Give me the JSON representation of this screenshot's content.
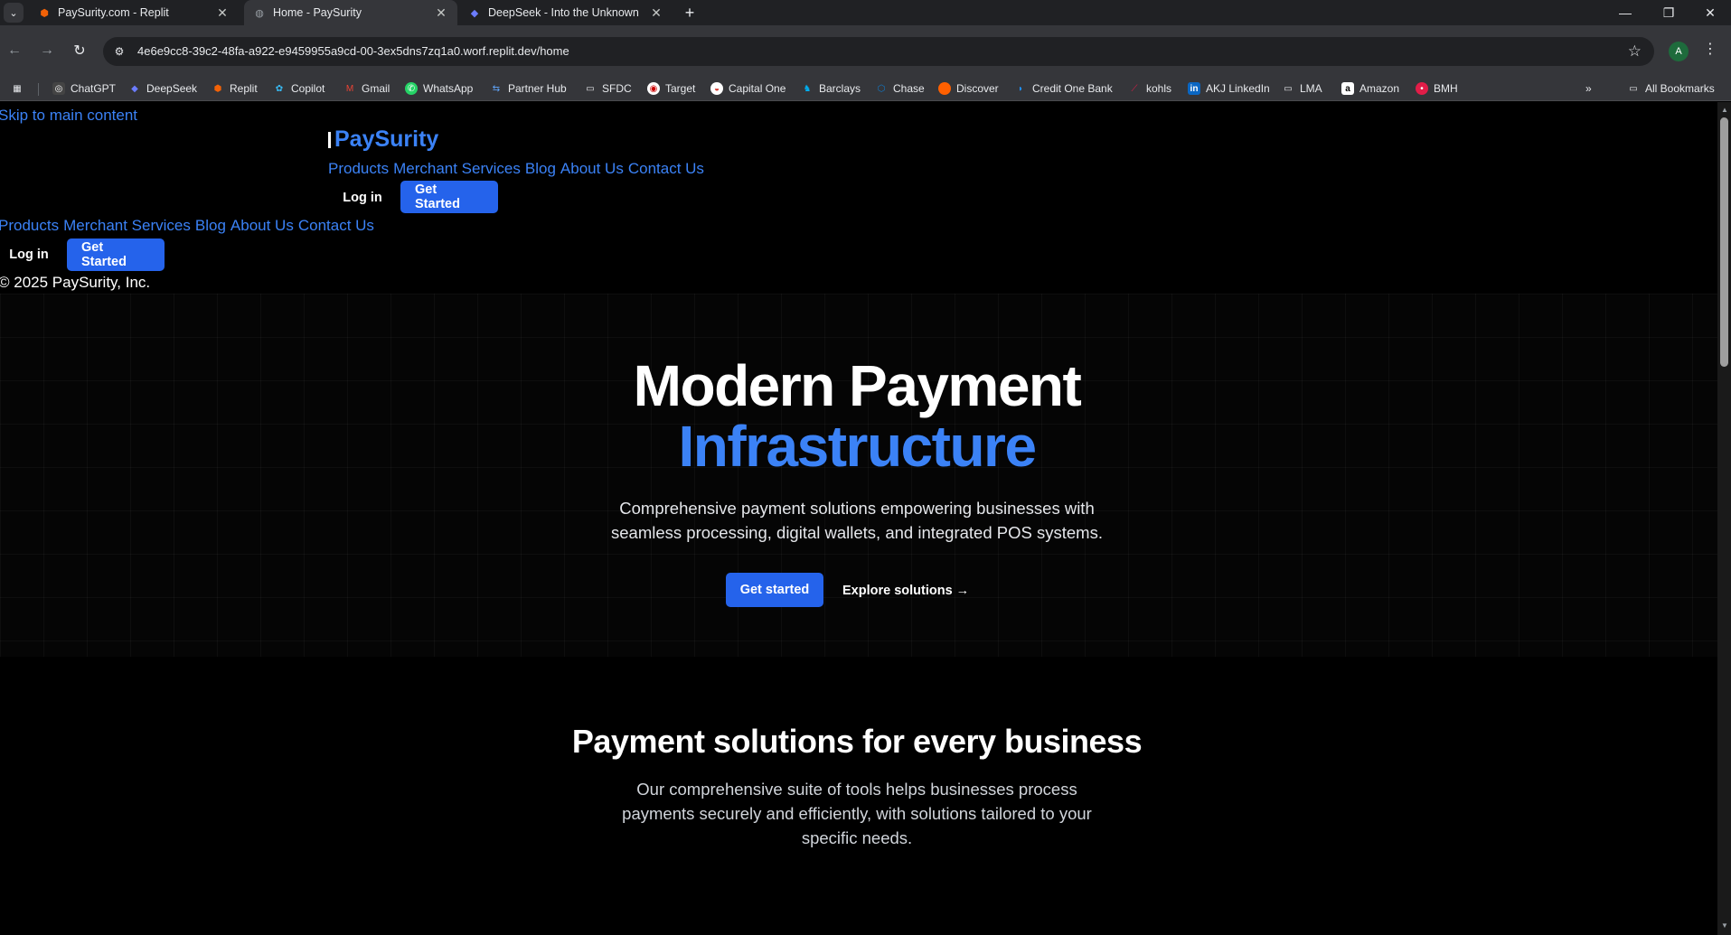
{
  "browser": {
    "tabs": [
      {
        "title": "PaySurity.com - Replit",
        "favicon": "replit-icon",
        "active": false
      },
      {
        "title": "Home - PaySurity",
        "favicon": "globe-icon",
        "active": true
      },
      {
        "title": "DeepSeek - Into the Unknown",
        "favicon": "deepseek-icon",
        "active": false
      }
    ],
    "url": "4e6e9cc8-39c2-48fa-a922-e9459955a9cd-00-3ex5dns7zq1a0.worf.replit.dev/home",
    "profile_initial": "A",
    "bookmarks": [
      "ChatGPT",
      "DeepSeek",
      "Replit",
      "Copilot",
      "Gmail",
      "WhatsApp",
      "Partner Hub",
      "SFDC",
      "Target",
      "Capital One",
      "Barclays",
      "Chase",
      "Discover",
      "Credit One Bank",
      "kohls",
      "AKJ LinkedIn",
      "LMA",
      "Amazon",
      "BMH"
    ],
    "all_bookmarks": "All Bookmarks"
  },
  "page": {
    "skip_link": "Skip to main content",
    "brand": "PaySurity",
    "nav": [
      "Products",
      "Merchant Services",
      "Blog",
      "About Us",
      "Contact Us"
    ],
    "login": "Log in",
    "get_started": "Get Started",
    "copyright": "© 2025 PaySurity, Inc.",
    "hero": {
      "title_line1": "Modern Payment",
      "title_line2": "Infrastructure",
      "subtitle": "Comprehensive payment solutions empowering businesses with seamless processing, digital wallets, and integrated POS systems.",
      "cta_primary": "Get started",
      "cta_secondary": "Explore solutions →"
    },
    "section": {
      "title": "Payment solutions for every business",
      "subtitle": "Our comprehensive suite of tools helps businesses process payments securely and efficiently, with solutions tailored to your specific needs."
    }
  },
  "colors": {
    "accent": "#3b82f6",
    "button": "#2563eb",
    "background": "#000000"
  }
}
